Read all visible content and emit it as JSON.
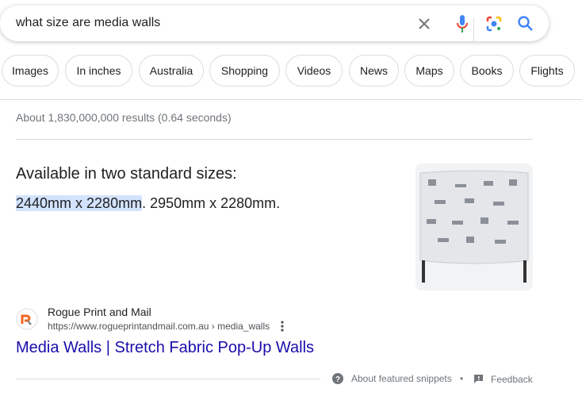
{
  "search": {
    "query": "what size are media walls"
  },
  "chips": [
    "Images",
    "In inches",
    "Australia",
    "Shopping",
    "Videos",
    "News",
    "Maps",
    "Books",
    "Flights"
  ],
  "stats": "About 1,830,000,000 results (0.64 seconds)",
  "snippet": {
    "heading": "Available in two standard sizes:",
    "highlight": "2440mm x 2280mm",
    "rest": ". 2950mm x 2280mm."
  },
  "result": {
    "site": "Rogue Print and Mail",
    "url": "https://www.rogueprintandmail.com.au",
    "path": " › media_walls",
    "title": "Media Walls | Stretch Fabric Pop-Up Walls"
  },
  "footer": {
    "about": "About featured snippets",
    "dot": "•",
    "feedback": "Feedback"
  },
  "colors": {
    "link": "#1a0dab",
    "search_blue": "#4285f4"
  }
}
